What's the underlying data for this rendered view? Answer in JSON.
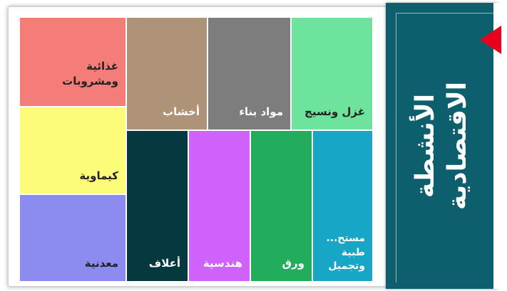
{
  "title": {
    "line1": "الأنشطة",
    "line2": "الاقتصادية"
  },
  "tiles": [
    {
      "label": "غذائية",
      "label2": "ومشروبات",
      "color": "#f47c79"
    },
    {
      "label": "أخشاب",
      "color": "#ae9379"
    },
    {
      "label": "مواد بناء",
      "color": "#7d7d7d"
    },
    {
      "label": "غزل ونسيج",
      "color": "#6de39d"
    },
    {
      "label": "كيماوية",
      "color": "#fdfb7a"
    },
    {
      "label": "معدنية",
      "color": "#8c8cf0"
    },
    {
      "label": "أعلاف",
      "color": "#06393f"
    },
    {
      "label": "هندسية",
      "color": "#cf62fa"
    },
    {
      "label": "ورق",
      "color": "#21ad5b"
    },
    {
      "label": "مستح...",
      "label2": "طبية",
      "label3": "وتجميل",
      "color": "#18a6c6"
    }
  ],
  "colors": {
    "banner": "#0e5f6e",
    "arrow": "#e8001c"
  }
}
